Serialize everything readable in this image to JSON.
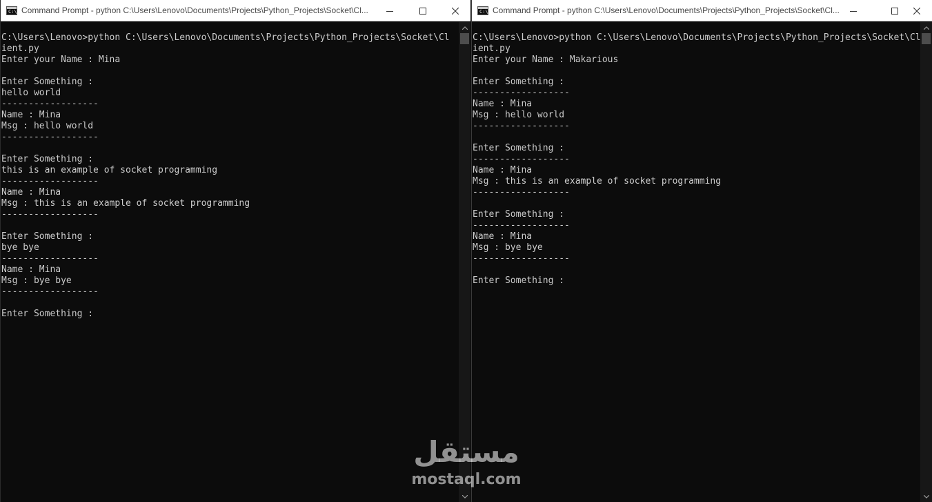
{
  "windows": [
    {
      "title": "Command Prompt - python  C:\\Users\\Lenovo\\Documents\\Projects\\Python_Projects\\Socket\\Cl...",
      "icon_text": "C:\\",
      "icon": "cmd-app-icon",
      "buttons": {
        "minimize": "minimize-icon",
        "maximize": "maximize-icon",
        "close": "close-icon"
      },
      "lines": [
        "C:\\Users\\Lenovo>python C:\\Users\\Lenovo\\Documents\\Projects\\Python_Projects\\Socket\\Cl",
        "ient.py",
        "Enter your Name : Mina",
        "",
        "Enter Something :",
        "hello world",
        "------------------",
        "Name : Mina",
        "Msg : hello world",
        "------------------",
        "",
        "Enter Something :",
        "this is an example of socket programming",
        "------------------",
        "Name : Mina",
        "Msg : this is an example of socket programming",
        "------------------",
        "",
        "Enter Something :",
        "bye bye",
        "------------------",
        "Name : Mina",
        "Msg : bye bye",
        "------------------",
        "",
        "Enter Something :"
      ]
    },
    {
      "title": "Command Prompt - python  C:\\Users\\Lenovo\\Documents\\Projects\\Python_Projects\\Socket\\Cl...",
      "icon_text": "C:\\",
      "icon": "cmd-app-icon",
      "buttons": {
        "minimize": "minimize-icon",
        "maximize": "maximize-icon",
        "close": "close-icon"
      },
      "lines": [
        "C:\\Users\\Lenovo>python C:\\Users\\Lenovo\\Documents\\Projects\\Python_Projects\\Socket\\Cl",
        "ient.py",
        "Enter your Name : Makarious",
        "",
        "Enter Something :",
        "------------------",
        "Name : Mina",
        "Msg : hello world",
        "------------------",
        "",
        "Enter Something :",
        "------------------",
        "Name : Mina",
        "Msg : this is an example of socket programming",
        "------------------",
        "",
        "Enter Something :",
        "------------------",
        "Name : Mina",
        "Msg : bye bye",
        "------------------",
        "",
        "Enter Something :"
      ]
    }
  ],
  "watermark": {
    "main": "مستقل",
    "sub": "mostaql.com"
  },
  "colors": {
    "console_bg": "#0c0c0c",
    "console_text": "#cccccc",
    "titlebar_bg": "#ffffff",
    "title_text": "#4a4a4a",
    "scrollbar_track": "#171717",
    "scrollbar_thumb": "#4d4d4d"
  }
}
